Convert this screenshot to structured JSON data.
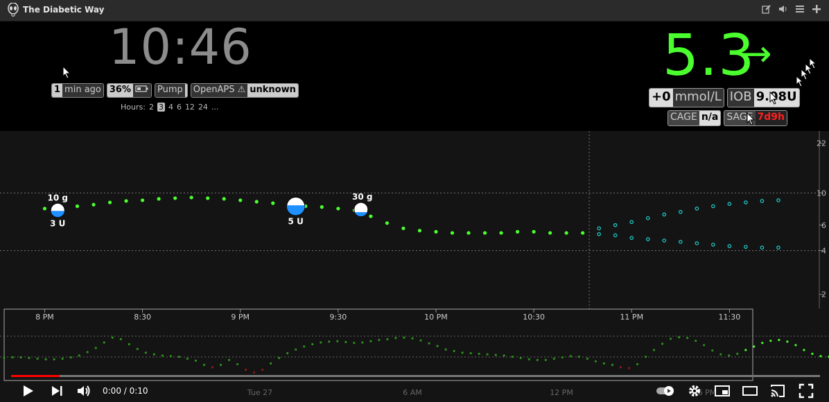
{
  "window": {
    "title": "The Diabetic Way"
  },
  "toolbar_icons": [
    "edit-icon",
    "speaker-icon",
    "menu-icon",
    "plus-icon"
  ],
  "clock": "10:46",
  "status_pills": [
    {
      "label": "min ago",
      "value": "1",
      "value_first": true
    },
    {
      "value": "36%",
      "label": "battery-icon"
    },
    {
      "label": "Pump",
      "value": ""
    },
    {
      "label": "OpenAPS ⚠",
      "value": "unknown"
    }
  ],
  "hours": {
    "label": "Hours:",
    "options": [
      "2",
      "3",
      "4",
      "6",
      "12",
      "24",
      "..."
    ],
    "selected": "3"
  },
  "bg": {
    "value": "5.3",
    "arrow": "→",
    "delta": "+0",
    "units": "mmol/L",
    "iob_label": "IOB",
    "iob_value": "9.08U"
  },
  "ages": [
    {
      "label": "CAGE",
      "value": "n/a",
      "alert": false
    },
    {
      "label": "SAGE",
      "value": "7d9h",
      "alert": true
    }
  ],
  "chart_data": {
    "type": "scatter",
    "title": "",
    "x_labels": [
      "8 PM",
      "8:30",
      "9 PM",
      "9:30",
      "10 PM",
      "10:30",
      "11 PM",
      "11:30"
    ],
    "y_ticks": [
      22,
      10,
      6,
      4,
      2
    ],
    "y_scale": "log",
    "y_range": [
      1.6,
      25
    ],
    "target_range": [
      4,
      10
    ],
    "bg_series": [
      {
        "t": 0,
        "v": 7.8
      },
      {
        "t": 5,
        "v": 7.9
      },
      {
        "t": 10,
        "v": 8.1
      },
      {
        "t": 15,
        "v": 8.3
      },
      {
        "t": 20,
        "v": 8.6
      },
      {
        "t": 25,
        "v": 8.8
      },
      {
        "t": 30,
        "v": 8.9
      },
      {
        "t": 35,
        "v": 9.1
      },
      {
        "t": 40,
        "v": 9.2
      },
      {
        "t": 45,
        "v": 9.3
      },
      {
        "t": 50,
        "v": 9.2
      },
      {
        "t": 55,
        "v": 9.1
      },
      {
        "t": 60,
        "v": 8.9
      },
      {
        "t": 65,
        "v": 8.7
      },
      {
        "t": 70,
        "v": 8.5
      },
      {
        "t": 75,
        "v": 8.3
      },
      {
        "t": 80,
        "v": 8.1
      },
      {
        "t": 85,
        "v": 8.0
      },
      {
        "t": 90,
        "v": 7.8
      },
      {
        "t": 95,
        "v": 7.6
      },
      {
        "t": 100,
        "v": 6.9
      },
      {
        "t": 105,
        "v": 6.2
      },
      {
        "t": 110,
        "v": 5.7
      },
      {
        "t": 115,
        "v": 5.5
      },
      {
        "t": 120,
        "v": 5.4
      },
      {
        "t": 125,
        "v": 5.3
      },
      {
        "t": 130,
        "v": 5.3
      },
      {
        "t": 135,
        "v": 5.3
      },
      {
        "t": 140,
        "v": 5.3
      },
      {
        "t": 145,
        "v": 5.4
      },
      {
        "t": 150,
        "v": 5.4
      },
      {
        "t": 155,
        "v": 5.3
      },
      {
        "t": 160,
        "v": 5.3
      },
      {
        "t": 165,
        "v": 5.3
      }
    ],
    "prediction_high": [
      {
        "t": 170,
        "v": 5.7
      },
      {
        "t": 175,
        "v": 6.0
      },
      {
        "t": 180,
        "v": 6.3
      },
      {
        "t": 185,
        "v": 6.7
      },
      {
        "t": 190,
        "v": 7.1
      },
      {
        "t": 195,
        "v": 7.4
      },
      {
        "t": 200,
        "v": 7.8
      },
      {
        "t": 205,
        "v": 8.1
      },
      {
        "t": 210,
        "v": 8.4
      },
      {
        "t": 215,
        "v": 8.6
      },
      {
        "t": 220,
        "v": 8.8
      },
      {
        "t": 225,
        "v": 8.9
      }
    ],
    "prediction_low": [
      {
        "t": 170,
        "v": 5.2
      },
      {
        "t": 175,
        "v": 5.1
      },
      {
        "t": 180,
        "v": 4.9
      },
      {
        "t": 185,
        "v": 4.8
      },
      {
        "t": 190,
        "v": 4.7
      },
      {
        "t": 195,
        "v": 4.6
      },
      {
        "t": 200,
        "v": 4.5
      },
      {
        "t": 205,
        "v": 4.4
      },
      {
        "t": 210,
        "v": 4.3
      },
      {
        "t": 215,
        "v": 4.25
      },
      {
        "t": 220,
        "v": 4.2
      },
      {
        "t": 225,
        "v": 4.2
      }
    ],
    "treatments": [
      {
        "t": 4,
        "v": 7.6,
        "carbs": "10 g",
        "insulin": "3 U",
        "fill": 0.45
      },
      {
        "t": 77,
        "v": 8.1,
        "carbs": "",
        "insulin": "5 U",
        "fill": 0.55
      },
      {
        "t": 97,
        "v": 7.7,
        "carbs": "30 g",
        "insulin": "",
        "fill": 0.3
      }
    ],
    "now_t": 167,
    "x_span": [
      -12,
      235
    ],
    "overview_labels": [
      "Tue 27",
      "6 AM",
      "12 PM",
      "6 PM"
    ],
    "overview_values": [
      6.2,
      6.3,
      6.3,
      6.2,
      6.1,
      6.0,
      6.0,
      6.1,
      6.3,
      6.6,
      7.2,
      8.0,
      9.2,
      10.4,
      10.0,
      8.8,
      7.8,
      7.1,
      6.8,
      6.6,
      6.5,
      6.4,
      6.1,
      5.8,
      5.2,
      4.9,
      5.2,
      5.9,
      5.3,
      4.6,
      4.3,
      4.6,
      5.4,
      6.2,
      7.0,
      7.7,
      8.3,
      8.8,
      9.2,
      9.4,
      9.5,
      9.3,
      9.1,
      9.2,
      9.5,
      9.8,
      10.0,
      10.3,
      10.4,
      10.2,
      9.7,
      9.0,
      8.4,
      7.7,
      7.4,
      7.1,
      7.0,
      6.9,
      6.8,
      6.7,
      6.6,
      6.4,
      6.2,
      6.0,
      5.9,
      5.9,
      6.1,
      6.3,
      6.5,
      6.4,
      6.1,
      5.7,
      5.4,
      5.2,
      4.9,
      4.8,
      5.3,
      6.4,
      7.6,
      8.9,
      10.1,
      10.5,
      10.3,
      9.6,
      8.6,
      7.5,
      6.8,
      6.6,
      6.9,
      7.6,
      8.3,
      9.1,
      9.6,
      9.8,
      9.4,
      8.6,
      7.6,
      6.9,
      6.5,
      6.4
    ]
  },
  "player": {
    "time": "0:00 / 0:10",
    "progress": 0.06
  }
}
